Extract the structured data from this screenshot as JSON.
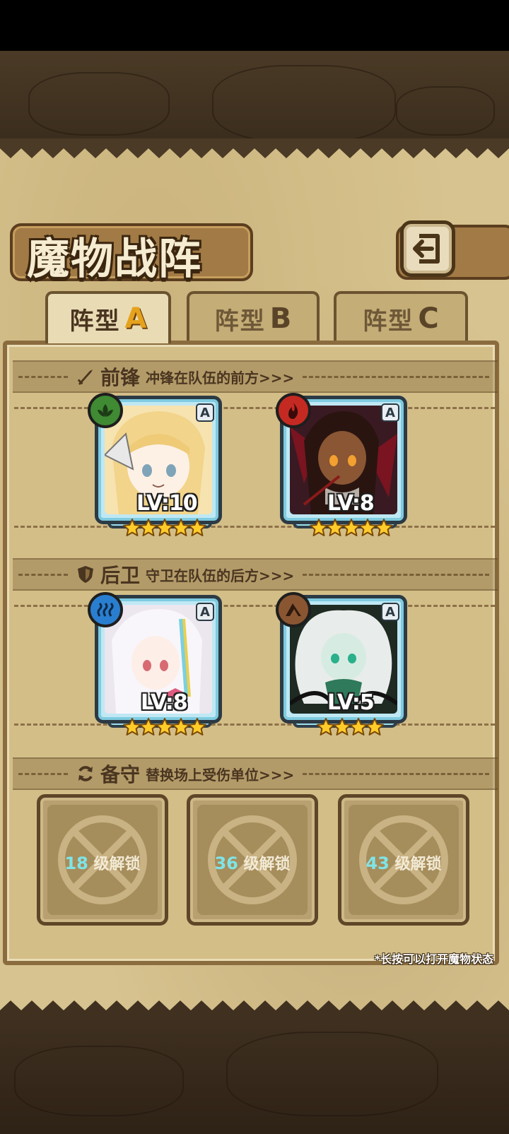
{
  "title": "魔物战阵",
  "back_button": {
    "icon": "return-arrow-icon"
  },
  "tabs": [
    {
      "label": "阵型",
      "letter": "A",
      "active": true
    },
    {
      "label": "阵型",
      "letter": "B",
      "active": false
    },
    {
      "label": "阵型",
      "letter": "C",
      "active": false
    }
  ],
  "vanguard": {
    "title": "前锋",
    "desc": "冲锋在队伍的前方>>>",
    "icon": "sword-icon",
    "monsters": [
      {
        "level": "LV:10",
        "rank": "A",
        "element": "nature",
        "element_color": "#3f8a32",
        "stars": 5
      },
      {
        "level": "LV:8",
        "rank": "A",
        "element": "fire",
        "element_color": "#c42a22",
        "stars": 5
      }
    ]
  },
  "rearguard": {
    "title": "后卫",
    "desc": "守卫在队伍的后方>>>",
    "icon": "shield-icon",
    "monsters": [
      {
        "level": "LV:8",
        "rank": "A",
        "element": "water",
        "element_color": "#2a7ed0",
        "stars": 5
      },
      {
        "level": "LV:5",
        "rank": "A",
        "element": "earth",
        "element_color": "#8a5632",
        "stars": 4
      }
    ]
  },
  "reserve": {
    "title": "备守",
    "desc": "替换场上受伤单位>>>",
    "icon": "refresh-icon",
    "slots": [
      {
        "level": "18",
        "text": "级解锁"
      },
      {
        "level": "36",
        "text": "级解锁"
      },
      {
        "level": "43",
        "text": "级解锁"
      }
    ]
  },
  "hint": "*长按可以打开魔物状态",
  "colors": {
    "star": "#ffcc2a",
    "card_frame": "#bfe8f4",
    "parchment": "#d3be88"
  }
}
